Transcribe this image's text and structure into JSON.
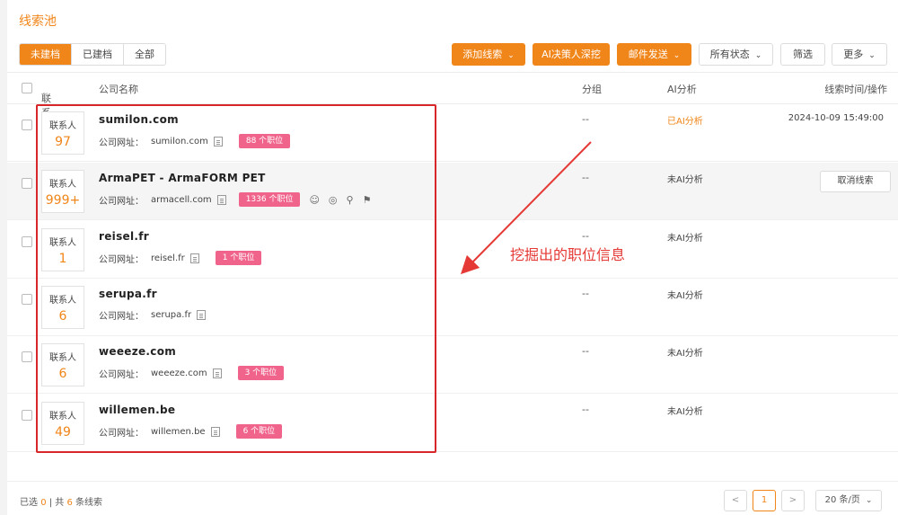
{
  "page_title": "线索池",
  "tabs": [
    {
      "label": "未建档",
      "active": true
    },
    {
      "label": "已建档",
      "active": false
    },
    {
      "label": "全部",
      "active": false
    }
  ],
  "toolbar": {
    "add_lead": "添加线索",
    "ai_decision": "AI决策人深挖",
    "send_mail": "邮件发送",
    "status": "所有状态",
    "filter": "筛选",
    "more": "更多"
  },
  "table": {
    "headers": {
      "contact": "联系人",
      "company": "公司名称",
      "group": "分组",
      "ai": "AI分析",
      "time": "线索时间/操作"
    },
    "contact_label": "联系人",
    "site_label": "公司网址：",
    "rows": [
      {
        "contacts": "97",
        "name": "sumilon.com",
        "url": "sumilon.com",
        "jobs": "88 个职位",
        "group": "--",
        "ai": "已AI分析",
        "time": "2024-10-09 15:49:00"
      },
      {
        "contacts": "999+",
        "name": "ArmaPET - ArmaFORM PET",
        "url": "armacell.com",
        "jobs": "1336 个职位",
        "group": "--",
        "ai": "未AI分析",
        "action": "取消线索"
      },
      {
        "contacts": "1",
        "name": "reisel.fr",
        "url": "reisel.fr",
        "jobs": "1 个职位",
        "group": "--",
        "ai": "未AI分析"
      },
      {
        "contacts": "6",
        "name": "serupa.fr",
        "url": "serupa.fr",
        "group": "--",
        "ai": "未AI分析"
      },
      {
        "contacts": "6",
        "name": "weeeze.com",
        "url": "weeeze.com",
        "jobs": "3 个职位",
        "group": "--",
        "ai": "未AI分析"
      },
      {
        "contacts": "49",
        "name": "willemen.be",
        "url": "willemen.be",
        "jobs": "6 个职位",
        "group": "--",
        "ai": "未AI分析"
      }
    ]
  },
  "annotation": "挖掘出的职位信息",
  "footer": {
    "selected_prefix": "已选",
    "selected_count": "0",
    "total_prefix": "| 共",
    "total_count": "6",
    "total_suffix": "条线索",
    "prev": "<",
    "page": "1",
    "next": ">",
    "page_size": "20 条/页"
  },
  "colors": {
    "accent": "#f08519",
    "badge": "#f0648c",
    "annotation": "#e53935"
  }
}
